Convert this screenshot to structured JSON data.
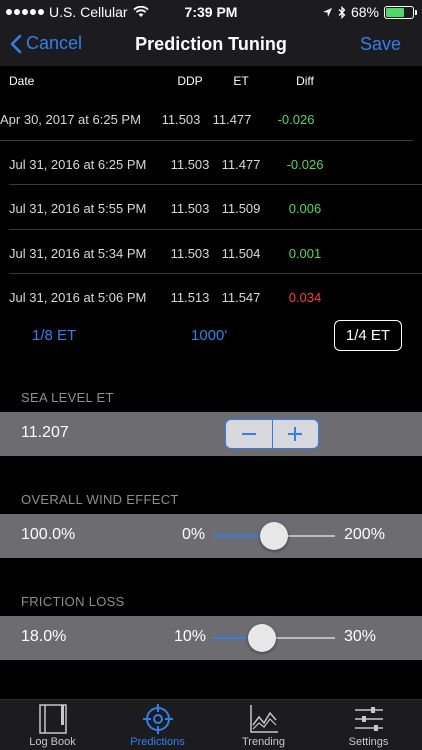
{
  "status": {
    "carrier": "U.S. Cellular",
    "time": "7:39 PM",
    "battery": "68%",
    "battery_level": 0.68
  },
  "nav": {
    "back_label": "Cancel",
    "title": "Prediction Tuning",
    "save_label": "Save"
  },
  "table": {
    "headers": {
      "date": "Date",
      "ddp": "DDP",
      "et": "ET",
      "diff": "Diff"
    },
    "rows": [
      {
        "date": "Apr 30, 2017 at 6:25 PM",
        "ddp": "11.503",
        "et": "11.477",
        "diff": "-0.026",
        "diff_color": "#4cd964"
      },
      {
        "date": "Jul 31, 2016 at 6:25 PM",
        "ddp": "11.503",
        "et": "11.477",
        "diff": "-0.026",
        "diff_color": "#4cd964"
      },
      {
        "date": "Jul 31, 2016 at 5:55 PM",
        "ddp": "11.503",
        "et": "11.509",
        "diff": "0.006",
        "diff_color": "#4cd964"
      },
      {
        "date": "Jul 31, 2016 at 5:34 PM",
        "ddp": "11.503",
        "et": "11.504",
        "diff": "0.001",
        "diff_color": "#4cd964"
      },
      {
        "date": "Jul 31, 2016 at 5:06 PM",
        "ddp": "11.513",
        "et": "11.547",
        "diff": "0.034",
        "diff_color": "#ff3b30"
      }
    ]
  },
  "segments": {
    "eighth": "1/8 ET",
    "feet": "1000'",
    "quarter": "1/4 ET"
  },
  "sea_level": {
    "label": "SEA LEVEL ET",
    "value": "11.207"
  },
  "wind": {
    "label": "OVERALL WIND EFFECT",
    "value": "100.0%",
    "min": "0%",
    "max": "200%",
    "level": 0.5
  },
  "friction": {
    "label": "FRICTION LOSS",
    "value": "18.0%",
    "min": "10%",
    "max": "30%",
    "level": 0.4
  },
  "tabs": {
    "logbook": "Log Book",
    "predictions": "Predictions",
    "trending": "Trending",
    "settings": "Settings"
  },
  "colors": {
    "accent": "#2f80ed",
    "positive": "#4cd964",
    "negative": "#ff3b30"
  }
}
